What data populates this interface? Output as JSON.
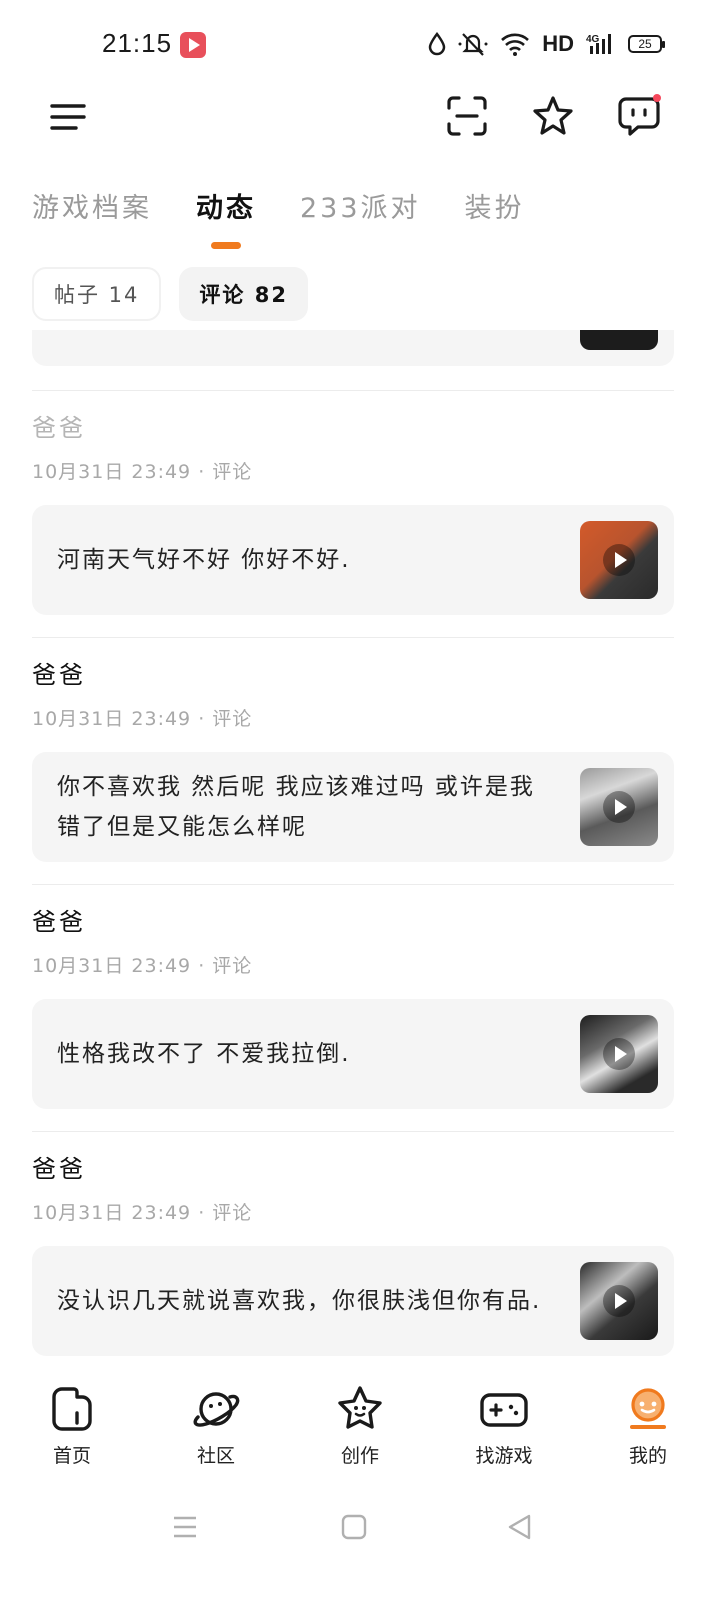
{
  "status_bar": {
    "time": "21:15",
    "network_label": "HD",
    "battery_level": "25"
  },
  "tabs": [
    {
      "label": "游戏档案",
      "active": false
    },
    {
      "label": "动态",
      "active": true
    },
    {
      "label": "233派对",
      "active": false
    },
    {
      "label": "装扮",
      "active": false
    }
  ],
  "chips": [
    {
      "label": "帖子 14"
    },
    {
      "label": "评论 82"
    }
  ],
  "comments": [
    {
      "author": "爸爸",
      "meta": "10月31日 23:49 · 评论",
      "text": "河南天气好不好 你好不好."
    },
    {
      "author": "爸爸",
      "meta": "10月31日 23:49 · 评论",
      "text": "你不喜欢我 然后呢 我应该难过吗 或许是我错了但是又能怎么样呢"
    },
    {
      "author": "爸爸",
      "meta": "10月31日 23:49 · 评论",
      "text": "性格我改不了 不爱我拉倒."
    },
    {
      "author": "爸爸",
      "meta": "10月31日 23:49 · 评论",
      "text": "没认识几天就说喜欢我，你很肤浅但你有品."
    }
  ],
  "bottom_nav": [
    {
      "label": "首页",
      "icon": "home-icon"
    },
    {
      "label": "社区",
      "icon": "planet-icon"
    },
    {
      "label": "创作",
      "icon": "star-face-icon"
    },
    {
      "label": "找游戏",
      "icon": "gamepad-icon"
    },
    {
      "label": "我的",
      "icon": "profile-icon"
    }
  ],
  "colors": {
    "accent": "#f07a1e",
    "card_bg": "#f5f5f5",
    "notification_dot": "#f5475b"
  }
}
